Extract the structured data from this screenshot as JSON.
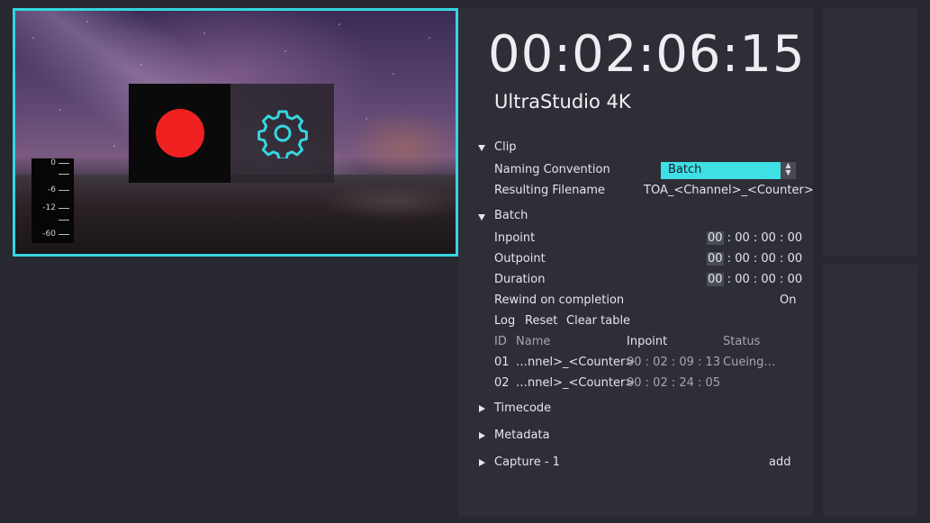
{
  "preview": {
    "meter_labels": [
      "0",
      "-6",
      "-12",
      "-60"
    ]
  },
  "timecode": "00:02:06:15",
  "device": "UltraStudio 4K",
  "clip": {
    "header": "Clip",
    "naming_label": "Naming Convention",
    "naming_value": "Batch",
    "filename_label": "Resulting Filename",
    "filename_value": "TOA_<Channel>_<Counter>"
  },
  "batch": {
    "header": "Batch",
    "inpoint_label": "Inpoint",
    "outpoint_label": "Outpoint",
    "duration_label": "Duration",
    "tc_first": "00",
    "tc_rest": " : 00 : 00 : 00",
    "rewind_label": "Rewind on completion",
    "rewind_value": "On",
    "actions": {
      "log": "Log",
      "reset": "Reset",
      "clear": "Clear table"
    },
    "table": {
      "headers": {
        "id": "ID",
        "name": "Name",
        "inpoint": "Inpoint",
        "status": "Status"
      },
      "rows": [
        {
          "id": "01",
          "name": "…nnel>_<Counter>",
          "inpoint": "00 : 02 : 09 : 13",
          "status": "Cueing…"
        },
        {
          "id": "02",
          "name": "…nnel>_<Counter>",
          "inpoint": "00 : 02 : 24 : 05",
          "status": ""
        }
      ]
    }
  },
  "sections": {
    "timecode": "Timecode",
    "metadata": "Metadata",
    "capture": "Capture - 1",
    "capture_add": "add"
  },
  "colors": {
    "accent": "#34d6e0",
    "record": "#ef2121"
  }
}
